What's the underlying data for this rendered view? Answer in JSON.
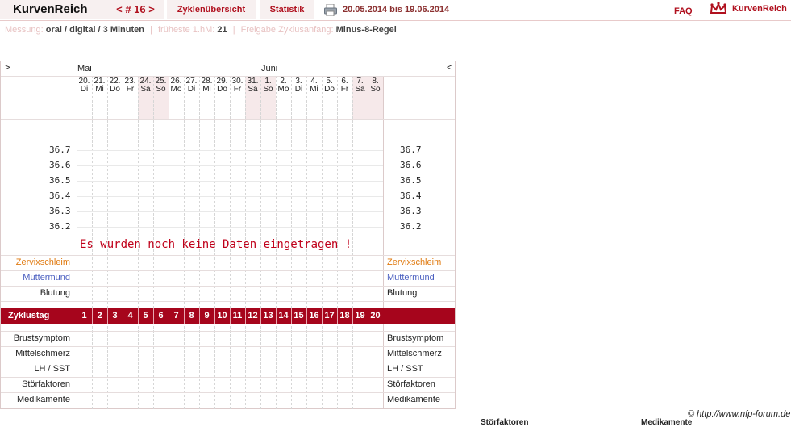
{
  "app": {
    "brand": "KurvenReich",
    "cycle_nav": "< # 16 >",
    "tabs": [
      {
        "label": "Zyklenübersicht"
      },
      {
        "label": "Statistik"
      }
    ],
    "date_range": "20.05.2014 bis 19.06.2014",
    "faq": "FAQ",
    "logo_text": "KurvenReich",
    "icons": [
      "printer-icon",
      "crown-logo-icon"
    ],
    "accent_color": "#a6051c"
  },
  "info": {
    "measure_label": "Messung:",
    "measure_value": "oral / digital / 3 Minuten",
    "earliest_label": "früheste 1.hM:",
    "earliest_value": "21",
    "release_label": "Freigabe Zyklusanfang:",
    "release_value": "Minus-8-Regel"
  },
  "chart": {
    "nav_prev": ">",
    "nav_next": "<",
    "months": [
      {
        "name": "Mai",
        "start": 0
      },
      {
        "name": "Juni",
        "start": 12
      }
    ],
    "days": [
      {
        "date": "20.",
        "wd": "Di",
        "weekend": false
      },
      {
        "date": "21.",
        "wd": "Mi",
        "weekend": false
      },
      {
        "date": "22.",
        "wd": "Do",
        "weekend": false
      },
      {
        "date": "23.",
        "wd": "Fr",
        "weekend": false
      },
      {
        "date": "24.",
        "wd": "Sa",
        "weekend": true
      },
      {
        "date": "25.",
        "wd": "So",
        "weekend": true
      },
      {
        "date": "26.",
        "wd": "Mo",
        "weekend": false
      },
      {
        "date": "27.",
        "wd": "Di",
        "weekend": false
      },
      {
        "date": "28.",
        "wd": "Mi",
        "weekend": false
      },
      {
        "date": "29.",
        "wd": "Do",
        "weekend": false
      },
      {
        "date": "30.",
        "wd": "Fr",
        "weekend": false
      },
      {
        "date": "31.",
        "wd": "Sa",
        "weekend": true
      },
      {
        "date": "1.",
        "wd": "So",
        "weekend": true
      },
      {
        "date": "2.",
        "wd": "Mo",
        "weekend": false
      },
      {
        "date": "3.",
        "wd": "Di",
        "weekend": false
      },
      {
        "date": "4.",
        "wd": "Mi",
        "weekend": false
      },
      {
        "date": "5.",
        "wd": "Do",
        "weekend": false
      },
      {
        "date": "6.",
        "wd": "Fr",
        "weekend": false
      },
      {
        "date": "7.",
        "wd": "Sa",
        "weekend": true
      },
      {
        "date": "8.",
        "wd": "So",
        "weekend": true
      }
    ],
    "temperatures": [
      "36.7",
      "36.6",
      "36.5",
      "36.4",
      "36.3",
      "36.2"
    ],
    "no_data_message": "Es wurden noch keine Daten eingetragen !",
    "upper_rows": [
      {
        "label": "Zervixschleim",
        "color": "#e07a10"
      },
      {
        "label": "Muttermund",
        "color": "#4b5fc0"
      },
      {
        "label": "Blutung",
        "color": "#222222"
      }
    ],
    "cycle_label": "Zyklustag",
    "cycle_days": [
      "1",
      "2",
      "3",
      "4",
      "5",
      "6",
      "7",
      "8",
      "9",
      "10",
      "11",
      "12",
      "13",
      "14",
      "15",
      "16",
      "17",
      "18",
      "19",
      "20"
    ],
    "lower_rows": [
      {
        "label": "Brustsymptom"
      },
      {
        "label": "Mittelschmerz"
      },
      {
        "label": "LH / SST"
      },
      {
        "label": "Störfaktoren"
      },
      {
        "label": "Medikamente"
      }
    ]
  },
  "footer": {
    "copyright": "© http://www.nfp-forum.de",
    "stoerfaktoren": "Störfaktoren",
    "medikamente": "Medikamente"
  }
}
